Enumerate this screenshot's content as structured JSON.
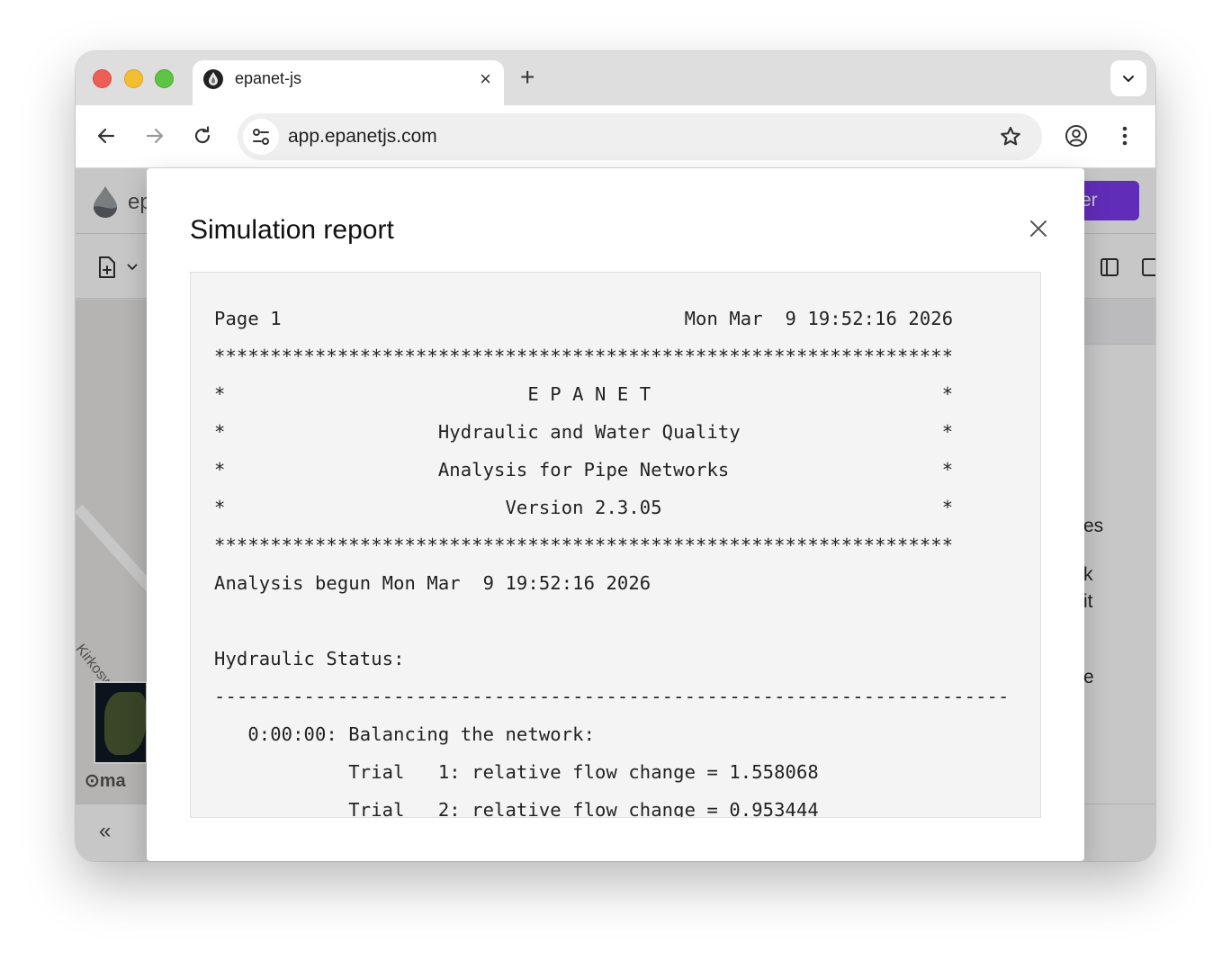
{
  "browser": {
    "tab_title": "epanet-js",
    "tab_close": "×",
    "new_tab": "+",
    "url": "app.epanetjs.com"
  },
  "app": {
    "name_partial": "ep",
    "register_partial": "ister",
    "side_fragments": [
      "es",
      "k",
      "it",
      "e"
    ],
    "street_partial": "Kirkosw",
    "mapbox_partial": "ma",
    "collapse_glyph": "«",
    "accent": "#7c3aed"
  },
  "modal": {
    "title": "Simulation report",
    "report_lines": [
      "Page 1                                    Mon Mar  9 19:52:16 2026",
      "******************************************************************",
      "*                           E P A N E T                          *",
      "*                   Hydraulic and Water Quality                  *",
      "*                   Analysis for Pipe Networks                   *",
      "*                         Version 2.3.05                         *",
      "******************************************************************",
      "Analysis begun Mon Mar  9 19:52:16 2026",
      "",
      "Hydraulic Status:",
      "-----------------------------------------------------------------------",
      "   0:00:00: Balancing the network:",
      "            Trial   1: relative flow change = 1.558068",
      "            Trial   2: relative flow change = 0.953444"
    ]
  }
}
